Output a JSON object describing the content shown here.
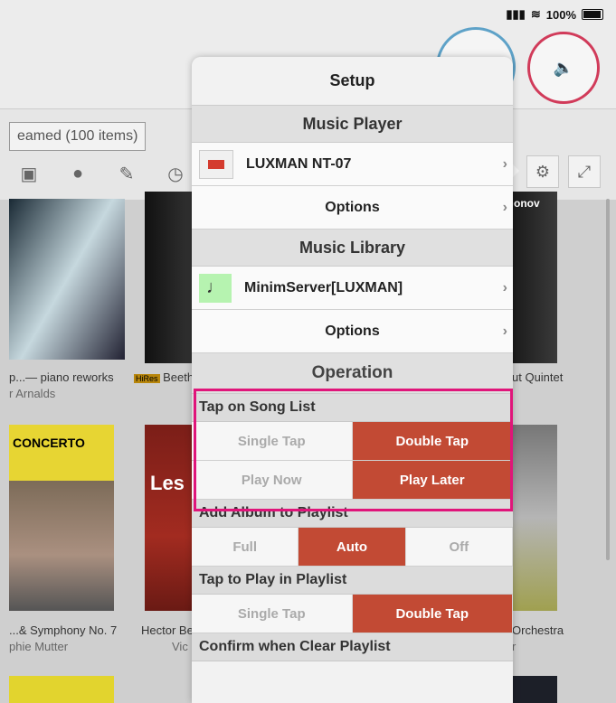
{
  "status": {
    "battery_text": "100%"
  },
  "library": {
    "streamed_label": "eamed (100 items)",
    "albums": [
      {
        "caption": "p...— piano reworks",
        "sub": "r Arnalds"
      },
      {
        "caption": "Beethov",
        "badge": "HiRes"
      },
      {
        "caption": "ut Quintet"
      },
      {
        "caption": "...& Symphony No. 7",
        "sub": "phie Mutter"
      },
      {
        "caption": "Hector Ber",
        "sub": "Vic"
      },
      {
        "caption": "Orchestra",
        "sub": "r"
      }
    ],
    "art_text": {
      "a4": "CONCERTO",
      "a5": "Les",
      "a3": "onov"
    }
  },
  "setup": {
    "title": "Setup",
    "music_player_header": "Music Player",
    "player_name": "LUXMAN NT-07",
    "player_options": "Options",
    "music_library_header": "Music Library",
    "library_name": "MinimServer[LUXMAN]",
    "library_options": "Options",
    "operation_header": "Operation",
    "groups": [
      {
        "title": "Tap on Song List",
        "rows": [
          [
            "Single Tap",
            "Double Tap"
          ],
          [
            "Play Now",
            "Play Later"
          ]
        ]
      },
      {
        "title": "Add Album to Playlist",
        "rows": [
          [
            "Full",
            "Auto",
            "Off"
          ]
        ]
      },
      {
        "title": "Tap to Play in Playlist",
        "rows": [
          [
            "Single Tap",
            "Double Tap"
          ]
        ]
      },
      {
        "title": "Confirm when Clear Playlist"
      }
    ]
  }
}
